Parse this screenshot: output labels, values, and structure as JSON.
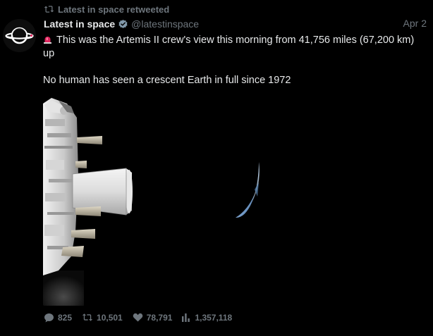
{
  "retweet": {
    "icon": "retweet-icon",
    "label": "Latest in space retweeted"
  },
  "author": {
    "avatar_icon": "saturn-logo-avatar",
    "name": "Latest in space",
    "verified_icon": "verified-badge-icon",
    "handle": "@latestinspace"
  },
  "date": "Apr 2",
  "tweet": {
    "emoji_icon": "siren-emoji-icon",
    "line1": "This was the Artemis II crew's view this morning from 41,756 miles (67,200 km) up",
    "line2": "No human has seen a crescent Earth in full since 1972"
  },
  "media": {
    "kind": "photo",
    "subject": "spacecraft-and-crescent-earth"
  },
  "stats": {
    "replies": "825",
    "retweets": "10,501",
    "likes": "78,791",
    "views": "1,357,118"
  },
  "colors": {
    "background": "#000000",
    "text": "#e7e9ea",
    "muted": "#6e767d",
    "verified": "#829aab",
    "siren": "#e0245e"
  }
}
